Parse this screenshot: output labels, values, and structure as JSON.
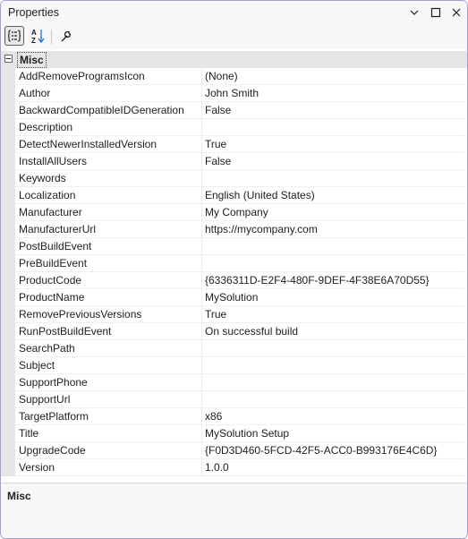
{
  "window": {
    "title": "Properties",
    "controls": [
      "chevron-down-icon",
      "maximize-icon",
      "close-icon"
    ]
  },
  "toolbar": {
    "categorized_tooltip": "Categorized",
    "alphabetical_tooltip": "Alphabetical",
    "property_pages_tooltip": "Property Pages",
    "alphabetical_glyph_top": "A",
    "alphabetical_glyph_bottom": "Z"
  },
  "category": {
    "label": "Misc",
    "expanded": true
  },
  "properties": [
    {
      "name": "AddRemoveProgramsIcon",
      "value": "(None)"
    },
    {
      "name": "Author",
      "value": "John Smith"
    },
    {
      "name": "BackwardCompatibleIDGeneration",
      "value": "False"
    },
    {
      "name": "Description",
      "value": ""
    },
    {
      "name": "DetectNewerInstalledVersion",
      "value": "True"
    },
    {
      "name": "InstallAllUsers",
      "value": "False"
    },
    {
      "name": "Keywords",
      "value": ""
    },
    {
      "name": "Localization",
      "value": "English (United States)"
    },
    {
      "name": "Manufacturer",
      "value": "My Company"
    },
    {
      "name": "ManufacturerUrl",
      "value": "https://mycompany.com"
    },
    {
      "name": "PostBuildEvent",
      "value": ""
    },
    {
      "name": "PreBuildEvent",
      "value": ""
    },
    {
      "name": "ProductCode",
      "value": "{6336311D-E2F4-480F-9DEF-4F38E6A70D55}"
    },
    {
      "name": "ProductName",
      "value": "MySolution"
    },
    {
      "name": "RemovePreviousVersions",
      "value": "True"
    },
    {
      "name": "RunPostBuildEvent",
      "value": "On successful build"
    },
    {
      "name": "SearchPath",
      "value": ""
    },
    {
      "name": "Subject",
      "value": ""
    },
    {
      "name": "SupportPhone",
      "value": ""
    },
    {
      "name": "SupportUrl",
      "value": ""
    },
    {
      "name": "TargetPlatform",
      "value": "x86"
    },
    {
      "name": "Title",
      "value": "MySolution Setup"
    },
    {
      "name": "UpgradeCode",
      "value": "{F0D3D460-5FCD-42F5-ACC0-B993176E4C6D}"
    },
    {
      "name": "Version",
      "value": "1.0.0"
    }
  ],
  "description": {
    "title": "Misc"
  },
  "colors": {
    "border": "#a99fcf",
    "chrome": "#f7f7f7",
    "gutter": "#e6e6e9",
    "accent_blue": "#1e6fd9"
  }
}
